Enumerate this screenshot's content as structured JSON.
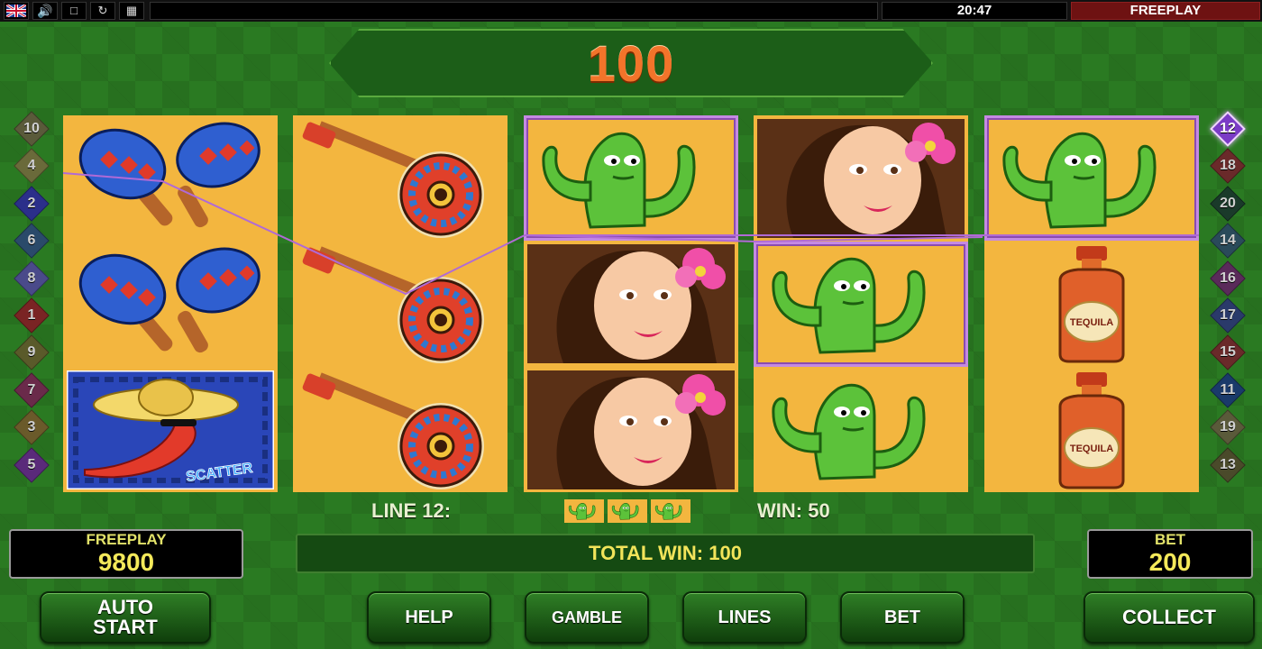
{
  "status_bar": {
    "language_icon": "uk-flag-icon",
    "sound_icon": "speaker-icon",
    "clock": "20:47",
    "mode": "FREEPLAY"
  },
  "win_banner": {
    "amount": "100"
  },
  "paylines_left": [
    "10",
    "4",
    "2",
    "6",
    "8",
    "1",
    "9",
    "7",
    "3",
    "5"
  ],
  "paylines_right": [
    "12",
    "18",
    "20",
    "14",
    "16",
    "17",
    "15",
    "11",
    "19",
    "13"
  ],
  "active_line": "12",
  "reels": [
    [
      "maracas",
      "maracas",
      "scatter"
    ],
    [
      "guitar",
      "guitar",
      "guitar"
    ],
    [
      "cactus",
      "woman",
      "woman"
    ],
    [
      "woman",
      "cactus",
      "cactus"
    ],
    [
      "cactus",
      "tequila",
      "tequila"
    ]
  ],
  "symbol_text": {
    "scatter": "SCATTER",
    "tequila": "TEQUILA"
  },
  "line_info": {
    "label": "LINE 12:",
    "win": "WIN: 50"
  },
  "credits_panel": {
    "caption": "FREEPLAY",
    "value": "9800"
  },
  "bet_panel": {
    "caption": "BET",
    "value": "200"
  },
  "total_win": "TOTAL WIN: 100",
  "buttons": {
    "auto_start": "AUTO\nSTART",
    "help": "HELP",
    "gamble": "GAMBLE",
    "lines": "LINES",
    "bet": "BET",
    "collect": "COLLECT"
  },
  "colors": {
    "background": "#2a7a22",
    "reel_background": "#f3b63f",
    "win_amount": "#f2742a",
    "panel_text": "#f4e95a",
    "highlight": "#c58ae2",
    "mode_badge": "#6e1212"
  }
}
